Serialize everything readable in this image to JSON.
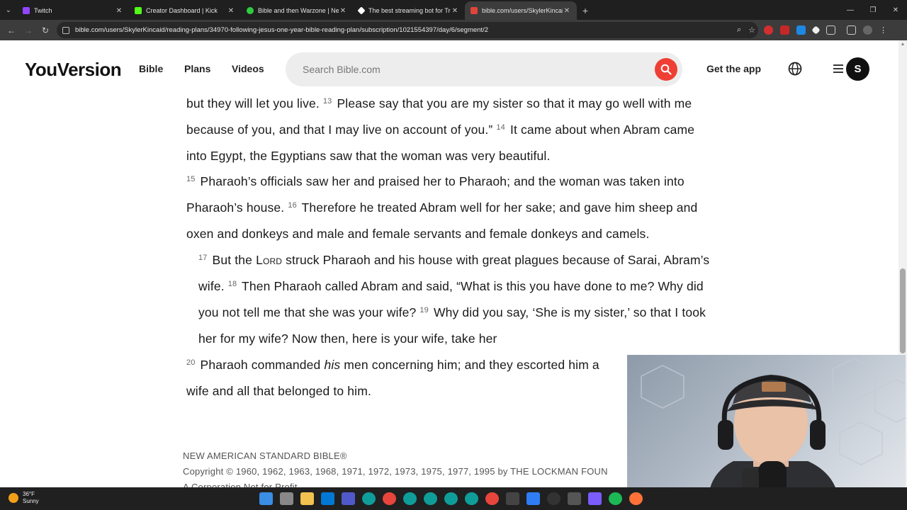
{
  "browser": {
    "tabs": [
      {
        "title": "Twitch",
        "favicon_color": "#9146ff",
        "active": false
      },
      {
        "title": "Creator Dashboard | Kick",
        "favicon_color": "#53fc18",
        "active": false
      },
      {
        "title": "Bible and then Warzone | New",
        "favicon_color": "#2ecc40",
        "active": false
      },
      {
        "title": "The best streaming bot for Tro",
        "favicon_color": "#ffffff",
        "active": false
      },
      {
        "title": "bible.com/users/SkylerKincaid/",
        "favicon_color": "#e0453a",
        "active": true
      }
    ],
    "url": "bible.com/users/SkylerKincaid/reading-plans/34970-following-jesus-one-year-bible-reading-plan/subscription/1021554397/day/6/segment/2"
  },
  "site": {
    "logo": "YouVersion",
    "nav": {
      "bible": "Bible",
      "plans": "Plans",
      "videos": "Videos"
    },
    "search_placeholder": "Search Bible.com",
    "get_app": "Get the app",
    "avatar_initial": "S",
    "brand_red": "#ef3f34"
  },
  "passage": {
    "p1_a": "but they will let you live. ",
    "v13": "13",
    "p1_b": " Please say that you are my sister so that it may go well with me because of you, and that I may live on account of you.” ",
    "v14": "14",
    "p1_c": " It came about when Abram came into Egypt, the Egyptians saw that the woman was very beautiful.",
    "v15": "15",
    "p2_a": " Pharaoh’s officials saw her and praised her to Pharaoh; and the woman was taken into Pharaoh’s house. ",
    "v16": "16",
    "p2_b": " Therefore he treated Abram well for her sake; and gave him sheep and oxen and donkeys and male and female servants and female donkeys and camels.",
    "v17": "17",
    "p3_a": " But the ",
    "lord": "Lord",
    "p3_b": " struck Pharaoh and his house with great plagues because of Sarai, Abram’s wife. ",
    "v18": "18",
    "p3_c": " Then Pharaoh called Abram and said, “What is this you have done to me? Why did you not tell me that she was your wife? ",
    "v19": "19",
    "p3_d": " Why did you say, ‘She is my sister,’ so that I took her for my wife? Now then, here is your wife, take her",
    "v20": "20",
    "p4_a": " Pharaoh commanded ",
    "his": "his",
    "p4_b": " men concerning him; and they escorted him a",
    "p4_c": "wife and all that belonged to him."
  },
  "copyright": {
    "line1": "NEW AMERICAN STANDARD BIBLE®",
    "line2": "Copyright © 1960, 1962, 1963, 1968, 1971, 1972, 1973, 1975, 1977, 1995 by THE LOCKMAN FOUN",
    "line3": "A Corporation Not for Profit"
  },
  "taskbar": {
    "weather_temp": "36°F",
    "weather_cond": "Sunny"
  }
}
